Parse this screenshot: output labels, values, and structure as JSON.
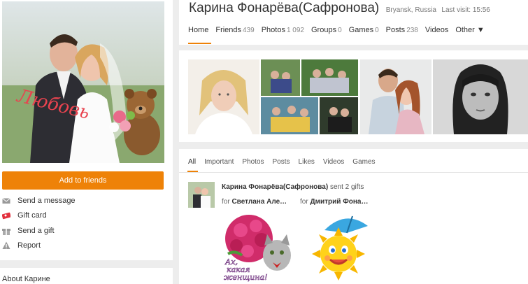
{
  "profile": {
    "name": "Карина Фонарёва(Сафронова)",
    "location": "Bryansk, Russia",
    "last_visit": "Last visit: 15:56",
    "avatar_caption": "Любовь"
  },
  "nav": [
    {
      "label": "Home",
      "count": ""
    },
    {
      "label": "Friends",
      "count": "439"
    },
    {
      "label": "Photos",
      "count": "1 092"
    },
    {
      "label": "Groups",
      "count": "0"
    },
    {
      "label": "Games",
      "count": "0"
    },
    {
      "label": "Posts",
      "count": "238"
    },
    {
      "label": "Videos",
      "count": ""
    },
    {
      "label": "Other ▼",
      "count": ""
    }
  ],
  "left": {
    "add_friends": "Add to friends",
    "actions": [
      {
        "label": "Send a message",
        "icon": "envelope-icon"
      },
      {
        "label": "Gift card",
        "icon": "gift-card-icon"
      },
      {
        "label": "Send a gift",
        "icon": "gift-icon"
      },
      {
        "label": "Report",
        "icon": "warning-icon"
      }
    ],
    "about": "About Карине"
  },
  "feed": {
    "tabs": [
      "All",
      "Important",
      "Photos",
      "Posts",
      "Likes",
      "Videos",
      "Games"
    ],
    "post": {
      "author": "Карина Фонарёва(Сафронова)",
      "action": "sent 2 gifts",
      "for_label": "for",
      "recipients": [
        "Светлана Але…",
        "Дмитрий Фона…"
      ],
      "gift1_text_line1": "Ах,",
      "gift1_text_line2": "какая",
      "gift1_text_line3": "женщина!"
    }
  },
  "colors": {
    "accent": "#ee8208",
    "background": "#ededed",
    "card": "#ffffff"
  }
}
